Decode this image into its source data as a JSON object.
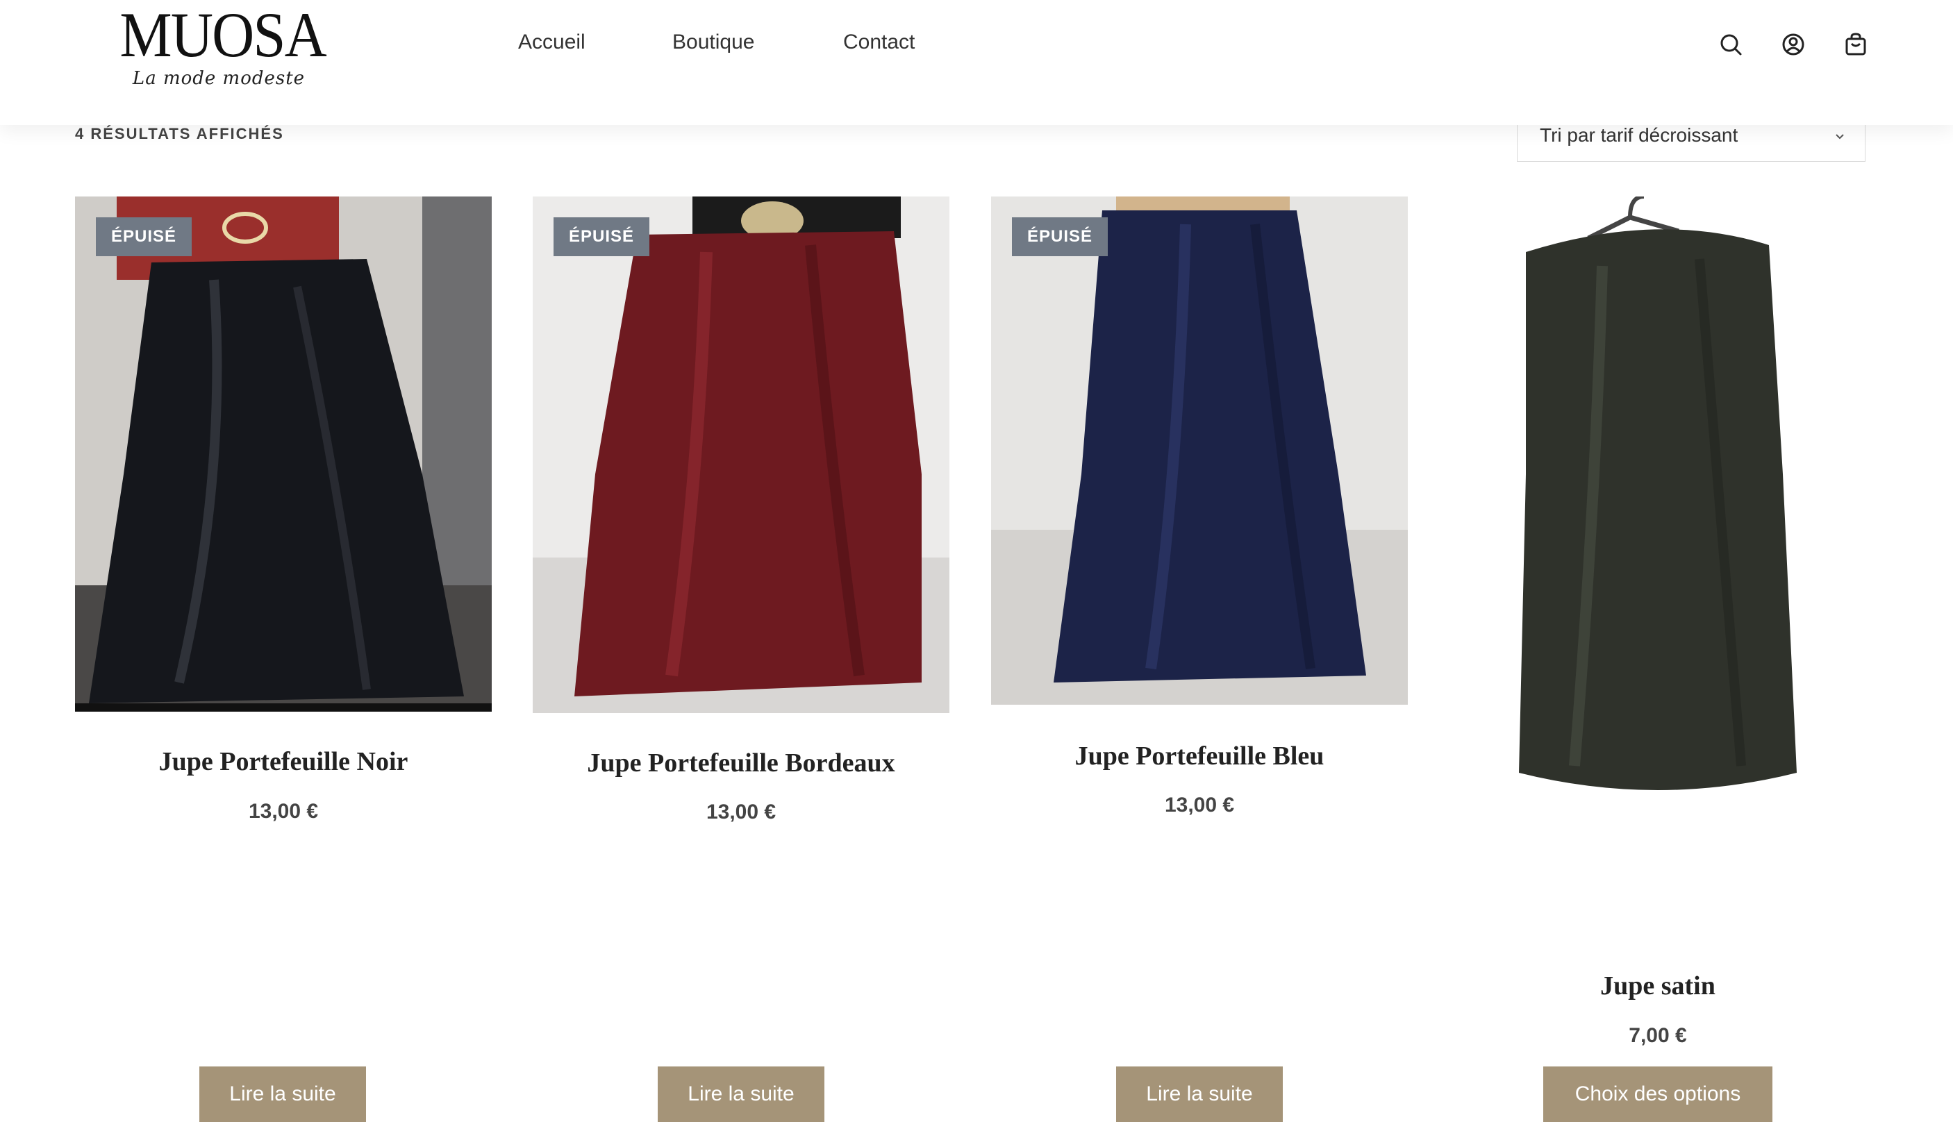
{
  "header": {
    "logo_text": "MUOSA",
    "logo_tagline": "La mode modeste",
    "nav": [
      "Accueil",
      "Boutique",
      "Contact"
    ],
    "icons": [
      "search-icon",
      "account-icon",
      "cart-icon"
    ]
  },
  "toolbar": {
    "results": "4 RÉSULTATS AFFICHÉS",
    "sort_selected": "Tri par tarif décroissant"
  },
  "colors": {
    "button": "#a59478",
    "badge": "#707985",
    "skirt_noir": "#15171c",
    "skirt_bordeaux": "#6e1a20",
    "skirt_bleu": "#1c2348",
    "skirt_satin": "#2f322b"
  },
  "products": [
    {
      "badge": "ÉPUISÉ",
      "title": "Jupe Portefeuille Noir",
      "price": "13,00 €",
      "button": "Lire la suite"
    },
    {
      "badge": "ÉPUISÉ",
      "title": "Jupe Portefeuille Bordeaux",
      "price": "13,00 €",
      "button": "Lire la suite"
    },
    {
      "badge": "ÉPUISÉ",
      "title": "Jupe Portefeuille Bleu",
      "price": "13,00 €",
      "button": "Lire la suite"
    },
    {
      "badge": "",
      "title": "Jupe satin",
      "price": "7,00 €",
      "button": "Choix des options"
    }
  ]
}
